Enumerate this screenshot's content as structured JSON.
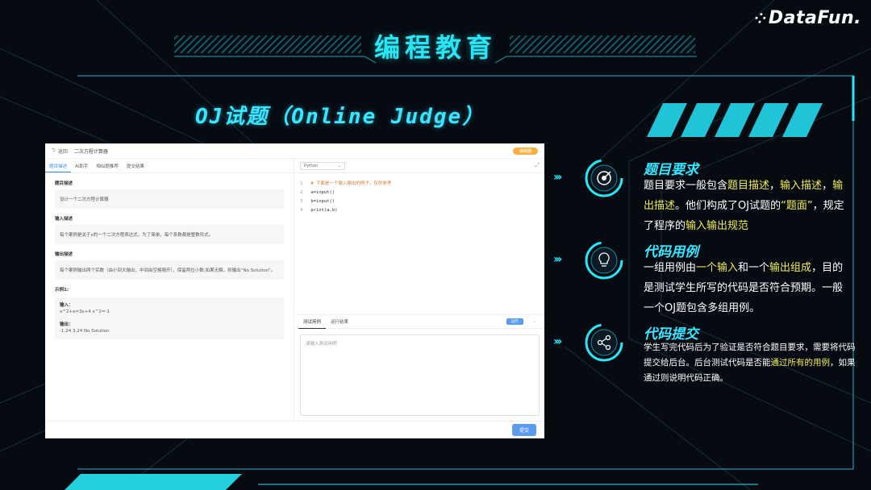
{
  "brand": "DataFun.",
  "title": "编程教育",
  "subtitle": "OJ试题（Online Judge）",
  "oj_window": {
    "back_label": "返回",
    "problem_title": "二次方程计算器",
    "theme_button": "编辑器",
    "tabs": [
      "题目描述",
      "AI助手",
      "相似题推荐",
      "提交结果"
    ],
    "sections": [
      {
        "heading": "题目描述",
        "body": "设计一个二次方程计算器"
      },
      {
        "heading": "输入描述",
        "body": "每个案例是关于x的一个二次方程表达式，为了简单，每个系数都是整数形式。"
      },
      {
        "heading": "输出描述",
        "body": "每个案例输出两个实数（由小到大输出，中间由空格隔开），保留两位小数;如果无解，则输出“No Solution”。"
      }
    ],
    "example_heading": "示例1:",
    "example": {
      "input_label": "输入：",
      "input_value": "x^2+x=3x+4 x^2=-1",
      "output_label": "输出：",
      "output_value": "-1.24 3.24 No Solution"
    },
    "language": "Python",
    "code_lines": [
      {
        "n": "1",
        "text": "# 下面是一个输入输出的例子，仅供参考",
        "comment": true
      },
      {
        "n": "2",
        "text": "a=input()",
        "comment": false
      },
      {
        "n": "3",
        "text": "b=input()",
        "comment": false
      },
      {
        "n": "4",
        "text": "print(a,b)",
        "comment": false
      }
    ],
    "test_tabs": [
      "测试用例",
      "运行结果"
    ],
    "run_button": "运行",
    "test_placeholder": "请输入测试用例",
    "submit_button": "提交"
  },
  "features": [
    {
      "title": "题目要求",
      "icon": "target-icon"
    },
    {
      "title": "代码用例",
      "icon": "lightbulb-icon"
    },
    {
      "title": "代码提交",
      "icon": "share-icon"
    }
  ],
  "f1": {
    "p1": "题目要求一般包含",
    "h1": "题目描述",
    "p2": "，",
    "h2": "输入描述",
    "p3": "，",
    "h3": "输出描述",
    "p4": "。他们构成了OJ试题的",
    "h4": "“题面”",
    "p5": "，规定了程序的",
    "h5": "输入输出规范"
  },
  "f2": {
    "p1": "一组用例由",
    "h1": "一个输入",
    "p2": "和一个",
    "h2": "输出组成",
    "p3": "，目的是测试学生所写的代码是否符合预期。一般一个OJ题包含多组用例。"
  },
  "f3": {
    "p1": "学生写完代码后为了验证是否符合题目要求，需要将代码提交给后台。后台测试代码是否能",
    "h1": "通过所有的用例",
    "p2": "，如果通过则说明代码正确。"
  },
  "colors": {
    "accent": "#29e6f5",
    "highlight": "#f0ec5a",
    "background": "#060b12",
    "button_blue": "#5b9bf0",
    "theme_orange": "#f5b041"
  }
}
